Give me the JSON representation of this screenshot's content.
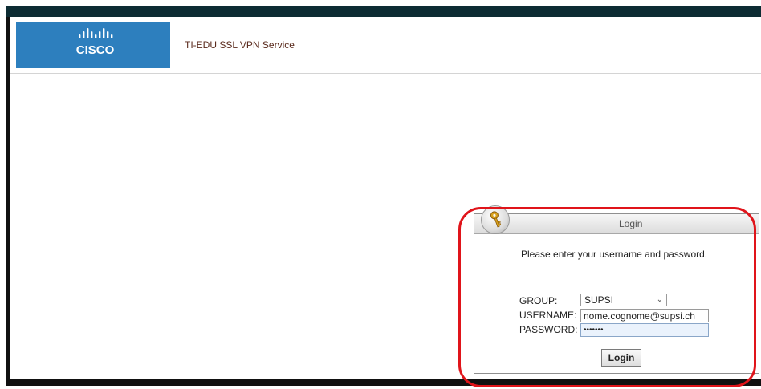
{
  "header": {
    "logo_text": "CISCO",
    "service_title": "TI-EDU SSL VPN Service"
  },
  "login": {
    "title": "Login",
    "prompt": "Please enter your username and password.",
    "group_label": "GROUP:",
    "group_value": "SUPSI",
    "username_label": "USERNAME:",
    "username_value": "nome.cognome@supsi.ch",
    "password_label": "PASSWORD:",
    "password_value": "•••••••",
    "button_label": "Login"
  },
  "colors": {
    "cisco_blue": "#2d7fbe",
    "title_text": "#5a2a1c",
    "highlight_red": "#e0141a"
  },
  "icons": {
    "key": "key-icon",
    "dropdown": "chevron-down-icon"
  }
}
